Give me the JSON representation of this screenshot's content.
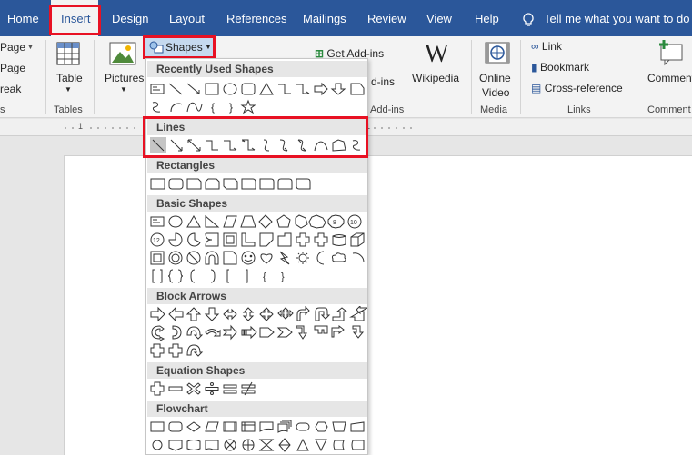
{
  "tabs": [
    {
      "label": "Home"
    },
    {
      "label": "Insert"
    },
    {
      "label": "Design"
    },
    {
      "label": "Layout"
    },
    {
      "label": "References"
    },
    {
      "label": "Mailings"
    },
    {
      "label": "Review"
    },
    {
      "label": "View"
    },
    {
      "label": "Help"
    }
  ],
  "tell_me": "Tell me what you want to do",
  "ribbon": {
    "pages": [
      "Page",
      "Page",
      "reak"
    ],
    "pages_group": "s",
    "table": "Table",
    "tables_group": "Tables",
    "pictures": "Pictures",
    "shapes": "Shapes",
    "get_addins": "Get Add-ins",
    "my_addins": "d-ins",
    "wikipedia": "Wikipedia",
    "addins_group": "Add-ins",
    "online_video_1": "Online",
    "online_video_2": "Video",
    "media_group": "Media",
    "link": "Link",
    "bookmark": "Bookmark",
    "cross_reference": "Cross-reference",
    "links_group": "Links",
    "comment": "Comment",
    "comments_group": "Comment"
  },
  "ruler": {
    "numbers": [
      "1",
      "1"
    ]
  },
  "shapes_menu": {
    "recent": "Recently Used Shapes",
    "lines": "Lines",
    "rectangles": "Rectangles",
    "basic": "Basic Shapes",
    "block_arrows": "Block Arrows",
    "equation": "Equation Shapes",
    "flowchart": "Flowchart"
  },
  "colors": {
    "brand": "#2b579a",
    "highlight": "#e81123"
  }
}
